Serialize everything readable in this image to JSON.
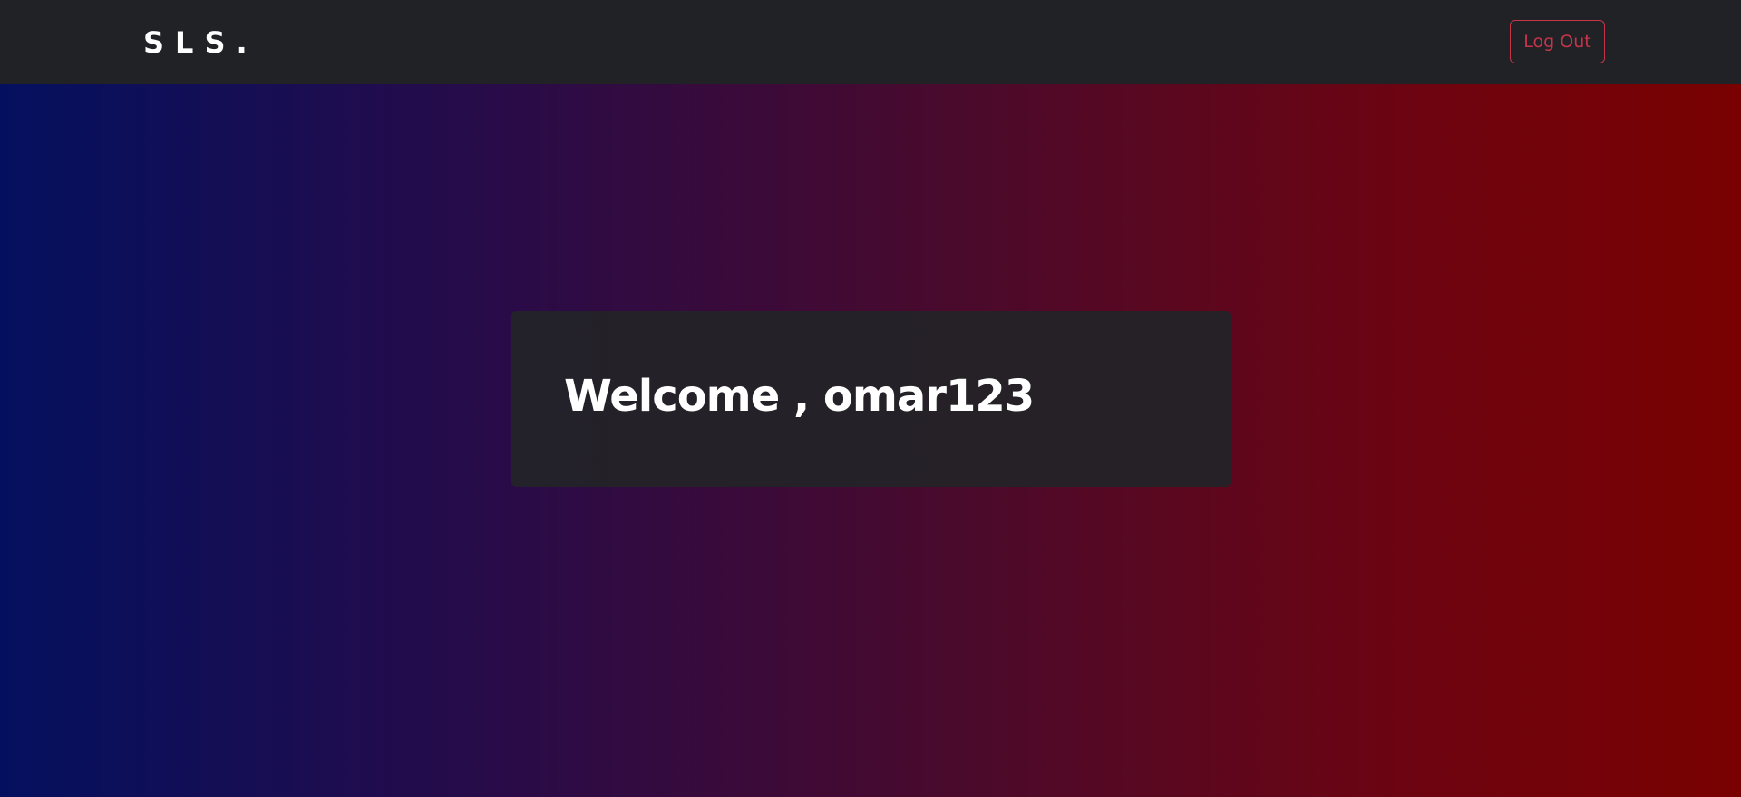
{
  "navbar": {
    "brand": "SLS.",
    "logout_label": "Log Out"
  },
  "welcome": {
    "title": "Welcome , omar123"
  },
  "colors": {
    "navbar_bg": "#212226",
    "accent_red": "#c6344a",
    "gradient_left": "#04105f",
    "gradient_right": "#790101",
    "card_bg": "#242128"
  }
}
